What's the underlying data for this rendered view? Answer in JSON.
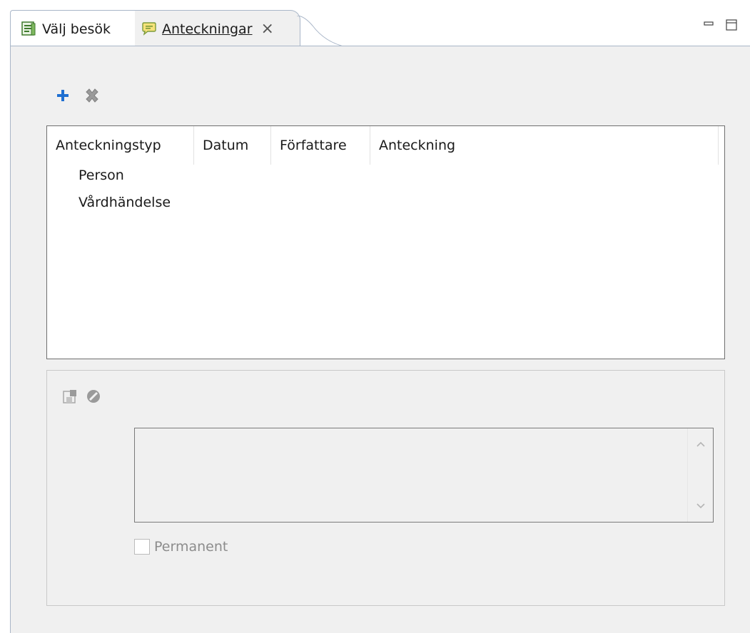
{
  "tabs": [
    {
      "label": "Välj besök",
      "icon": "list-window-icon",
      "active": false
    },
    {
      "label": "Anteckningar",
      "icon": "note-icon",
      "active": true,
      "closable": true
    }
  ],
  "tab_close_glyph": "×",
  "window_controls": {
    "minimize": "minimize-icon",
    "maximize": "maximize-icon"
  },
  "toolbar": {
    "add": "plus-icon",
    "delete": "delete-icon"
  },
  "table": {
    "columns": [
      "Anteckningstyp",
      "Datum",
      "Författare",
      "Anteckning"
    ],
    "rows": [
      "Person",
      "Vårdhändelse"
    ]
  },
  "editor": {
    "save": "save-icon",
    "cancel": "cancel-icon",
    "text_value": "",
    "checkbox_label": "Permanent",
    "checkbox_checked": false
  },
  "colors": {
    "add_icon": "#1f6fd1",
    "pane_bg": "#f0f0f0",
    "border": "#a9b6c8"
  }
}
